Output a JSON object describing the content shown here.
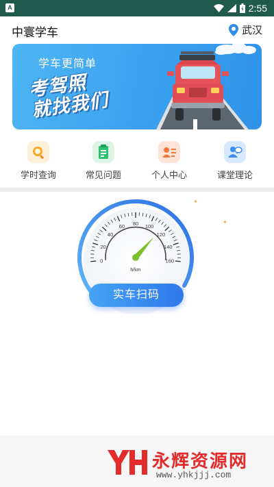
{
  "status_bar": {
    "time": "2:55",
    "notification_icon": "a-notification-icon",
    "icons": [
      "wifi-icon",
      "signal-icon",
      "battery-icon"
    ]
  },
  "header": {
    "title": "中寰学车",
    "location": "武汉",
    "location_icon": "map-pin-icon"
  },
  "banner": {
    "subtitle": "学车更简单",
    "headline": "考驾照 就找我们",
    "image": "red-suv-on-road"
  },
  "quick_nav": [
    {
      "label": "学时查询",
      "icon": "clock-search-icon",
      "color": "#f7a928"
    },
    {
      "label": "常见问题",
      "icon": "clipboard-icon",
      "color": "#2fbf71"
    },
    {
      "label": "个人中心",
      "icon": "contact-card-icon",
      "color": "#f4793b"
    },
    {
      "label": "课堂理论",
      "icon": "people-talk-icon",
      "color": "#3a8ef0"
    }
  ],
  "speedometer": {
    "ticks": [
      "0",
      "20",
      "40",
      "60",
      "80",
      "100",
      "120",
      "140",
      "160"
    ],
    "unit": "h/km",
    "needle_value": 115,
    "max_value": 160
  },
  "scan_button": {
    "label": "实车扫码"
  },
  "watermark": {
    "logo_text": "YH",
    "title": "永辉资源网",
    "url": "www.yhkjjj.com"
  },
  "colors": {
    "status_bar": "#1f5a4c",
    "accent_blue": "#2f79ea",
    "gauge_green": "#7cbf2f",
    "watermark_red": "#e22b2b"
  }
}
